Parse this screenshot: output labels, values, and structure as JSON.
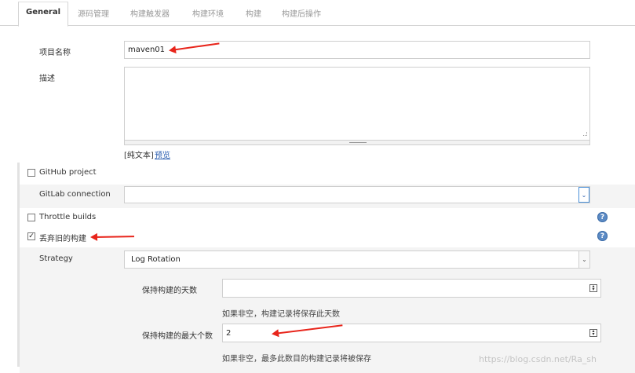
{
  "tabs": [
    "General",
    "源码管理",
    "构建触发器",
    "构建环境",
    "构建",
    "构建后操作"
  ],
  "form": {
    "project_name_label": "项目名称",
    "project_name_value": "maven01",
    "description_label": "描述",
    "description_value": "",
    "format_plain": "[纯文本]",
    "format_preview": "预览"
  },
  "options": {
    "github_project": {
      "label": "GitHub project",
      "checked": false
    },
    "gitlab_connection_label": "GitLab connection",
    "gitlab_connection_value": "",
    "throttle_builds": {
      "label": "Throttle builds",
      "checked": false
    },
    "discard_old": {
      "label": "丢弃旧的构建",
      "checked": true,
      "check_mark": "✓"
    }
  },
  "strategy": {
    "label": "Strategy",
    "value": "Log Rotation",
    "days_label": "保持构建的天数",
    "days_value": "",
    "days_hint": "如果非空，构建记录将保存此天数",
    "max_label": "保持构建的最大个数",
    "max_value": "2",
    "max_hint": "如果非空，最多此数目的构建记录将被保存"
  },
  "help_icon_glyph": "?",
  "watermark": "https://blog.csdn.net/Ra_sh",
  "colors": {
    "annotation_arrow": "#e8251b",
    "link": "#2a5db0",
    "help": "#5b8ac4"
  }
}
